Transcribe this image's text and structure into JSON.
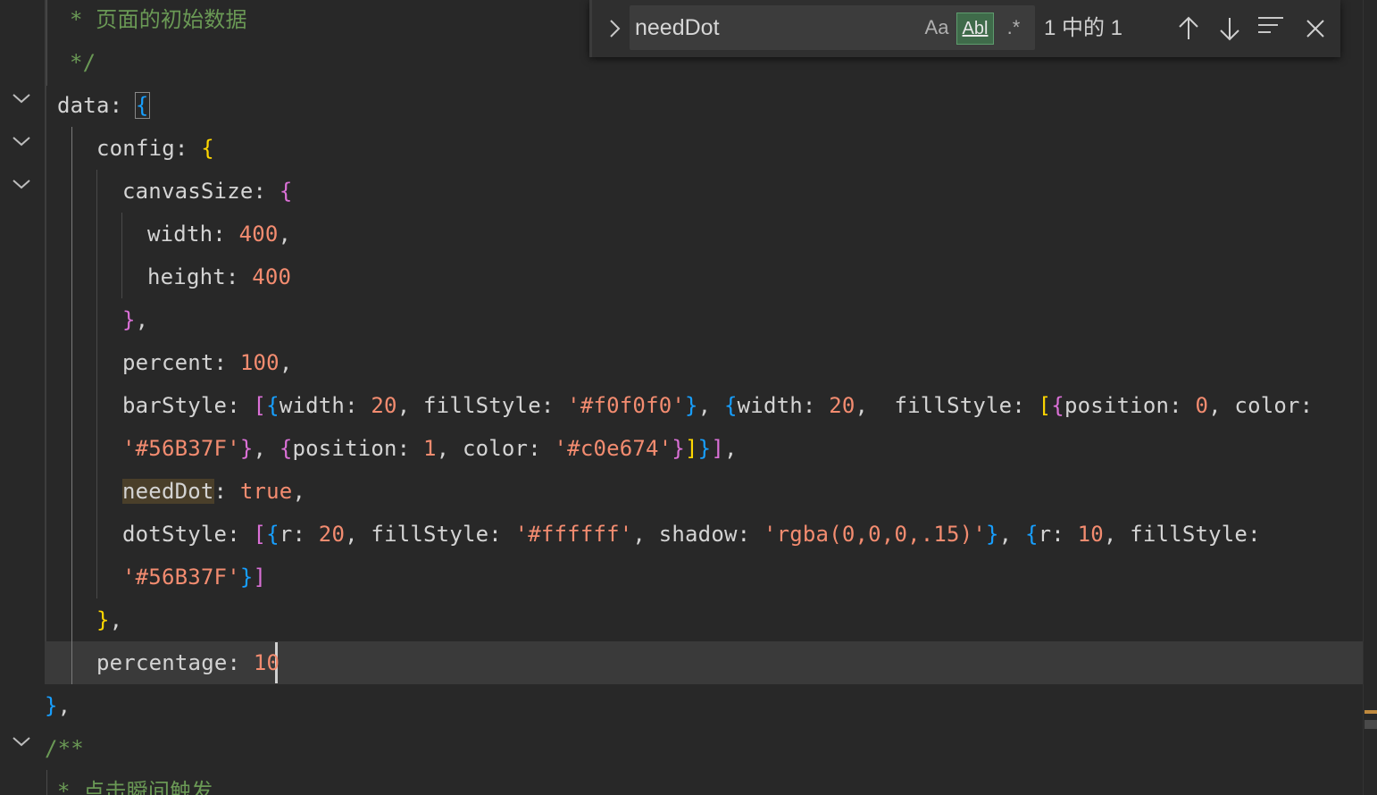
{
  "editor": {
    "lines": [
      {
        "tokens": [
          {
            "c": "cm",
            "t": "* 页面的初始数据"
          }
        ]
      },
      {
        "tokens": [
          {
            "c": "cm",
            "t": "*/"
          }
        ]
      },
      {
        "tokens": [
          {
            "c": "key",
            "t": "data"
          },
          {
            "c": "pun",
            "t": ": "
          },
          {
            "c": "b3 brk-box",
            "t": "{"
          }
        ]
      },
      {
        "tokens": [
          {
            "c": "key",
            "t": "config"
          },
          {
            "c": "pun",
            "t": ": "
          },
          {
            "c": "b1",
            "t": "{"
          }
        ]
      },
      {
        "tokens": [
          {
            "c": "key",
            "t": "canvasSize"
          },
          {
            "c": "pun",
            "t": ": "
          },
          {
            "c": "b2",
            "t": "{"
          }
        ]
      },
      {
        "tokens": [
          {
            "c": "key",
            "t": "width"
          },
          {
            "c": "pun",
            "t": ": "
          },
          {
            "c": "num",
            "t": "400"
          },
          {
            "c": "pun",
            "t": ","
          }
        ]
      },
      {
        "tokens": [
          {
            "c": "key",
            "t": "height"
          },
          {
            "c": "pun",
            "t": ": "
          },
          {
            "c": "num",
            "t": "400"
          }
        ]
      },
      {
        "tokens": [
          {
            "c": "b2",
            "t": "}"
          },
          {
            "c": "pun",
            "t": ","
          }
        ]
      },
      {
        "tokens": [
          {
            "c": "key",
            "t": "percent"
          },
          {
            "c": "pun",
            "t": ": "
          },
          {
            "c": "num",
            "t": "100"
          },
          {
            "c": "pun",
            "t": ","
          }
        ]
      },
      {
        "tokens": [
          {
            "c": "key",
            "t": "barStyle"
          },
          {
            "c": "pun",
            "t": ": "
          },
          {
            "c": "b2",
            "t": "["
          },
          {
            "c": "b3",
            "t": "{"
          },
          {
            "c": "key",
            "t": "width"
          },
          {
            "c": "pun",
            "t": ": "
          },
          {
            "c": "num",
            "t": "20"
          },
          {
            "c": "pun",
            "t": ", "
          },
          {
            "c": "key",
            "t": "fillStyle"
          },
          {
            "c": "pun",
            "t": ": "
          },
          {
            "c": "str",
            "t": "'#f0f0f0'"
          },
          {
            "c": "b3",
            "t": "}"
          },
          {
            "c": "pun",
            "t": ", "
          },
          {
            "c": "b3",
            "t": "{"
          },
          {
            "c": "key",
            "t": "width"
          },
          {
            "c": "pun",
            "t": ": "
          },
          {
            "c": "num",
            "t": "20"
          },
          {
            "c": "pun",
            "t": ",  "
          },
          {
            "c": "key",
            "t": "fillStyle"
          },
          {
            "c": "pun",
            "t": ": "
          },
          {
            "c": "b1",
            "t": "["
          },
          {
            "c": "b2",
            "t": "{"
          },
          {
            "c": "key",
            "t": "position"
          },
          {
            "c": "pun",
            "t": ": "
          },
          {
            "c": "num",
            "t": "0"
          },
          {
            "c": "pun",
            "t": ", "
          },
          {
            "c": "key",
            "t": "color"
          },
          {
            "c": "pun",
            "t": ":"
          }
        ]
      },
      {
        "tokens": [
          {
            "c": "str",
            "t": "'#56B37F'"
          },
          {
            "c": "b2",
            "t": "}"
          },
          {
            "c": "pun",
            "t": ", "
          },
          {
            "c": "b2",
            "t": "{"
          },
          {
            "c": "key",
            "t": "position"
          },
          {
            "c": "pun",
            "t": ": "
          },
          {
            "c": "num",
            "t": "1"
          },
          {
            "c": "pun",
            "t": ", "
          },
          {
            "c": "key",
            "t": "color"
          },
          {
            "c": "pun",
            "t": ": "
          },
          {
            "c": "str",
            "t": "'#c0e674'"
          },
          {
            "c": "b2",
            "t": "}"
          },
          {
            "c": "b1",
            "t": "]"
          },
          {
            "c": "b3",
            "t": "}"
          },
          {
            "c": "b2",
            "t": "]"
          },
          {
            "c": "pun",
            "t": ","
          }
        ]
      },
      {
        "tokens": [
          {
            "c": "key match",
            "t": "needDot"
          },
          {
            "c": "pun",
            "t": ": "
          },
          {
            "c": "kw",
            "t": "true"
          },
          {
            "c": "pun",
            "t": ","
          }
        ]
      },
      {
        "tokens": [
          {
            "c": "key",
            "t": "dotStyle"
          },
          {
            "c": "pun",
            "t": ": "
          },
          {
            "c": "b2",
            "t": "["
          },
          {
            "c": "b3",
            "t": "{"
          },
          {
            "c": "key",
            "t": "r"
          },
          {
            "c": "pun",
            "t": ": "
          },
          {
            "c": "num",
            "t": "20"
          },
          {
            "c": "pun",
            "t": ", "
          },
          {
            "c": "key",
            "t": "fillStyle"
          },
          {
            "c": "pun",
            "t": ": "
          },
          {
            "c": "str",
            "t": "'#ffffff'"
          },
          {
            "c": "pun",
            "t": ", "
          },
          {
            "c": "key",
            "t": "shadow"
          },
          {
            "c": "pun",
            "t": ": "
          },
          {
            "c": "str",
            "t": "'rgba(0,0,0,.15)'"
          },
          {
            "c": "b3",
            "t": "}"
          },
          {
            "c": "pun",
            "t": ", "
          },
          {
            "c": "b3",
            "t": "{"
          },
          {
            "c": "key",
            "t": "r"
          },
          {
            "c": "pun",
            "t": ": "
          },
          {
            "c": "num",
            "t": "10"
          },
          {
            "c": "pun",
            "t": ", "
          },
          {
            "c": "key",
            "t": "fillStyle"
          },
          {
            "c": "pun",
            "t": ":"
          }
        ]
      },
      {
        "tokens": [
          {
            "c": "str",
            "t": "'#56B37F'"
          },
          {
            "c": "b3",
            "t": "}"
          },
          {
            "c": "b2",
            "t": "]"
          }
        ]
      },
      {
        "tokens": [
          {
            "c": "b1",
            "t": "}"
          },
          {
            "c": "pun",
            "t": ","
          }
        ]
      },
      {
        "tokens": [
          {
            "c": "key",
            "t": "percentage"
          },
          {
            "c": "pun",
            "t": ": "
          },
          {
            "c": "num",
            "t": "10"
          }
        ]
      },
      {
        "tokens": [
          {
            "c": "b3",
            "t": "}"
          },
          {
            "c": "pun",
            "t": ","
          }
        ]
      },
      {
        "tokens": [
          {
            "c": "cm",
            "t": "/**"
          }
        ]
      },
      {
        "tokens": [
          {
            "c": "cm",
            "t": "* 点击瞬间触发"
          }
        ]
      }
    ]
  },
  "find_widget": {
    "query": "needDot",
    "match_case_label": "Aa",
    "whole_word_label": "Abl",
    "regex_label": ".*",
    "result_count": "1 中的 1",
    "whole_word_active": true
  },
  "icons": {
    "toggle_replace": "chevron-right-icon",
    "prev_match": "arrow-up-icon",
    "next_match": "arrow-down-icon",
    "find_in_selection": "lines-icon",
    "close": "close-icon",
    "fold": "chevron-down-icon"
  }
}
